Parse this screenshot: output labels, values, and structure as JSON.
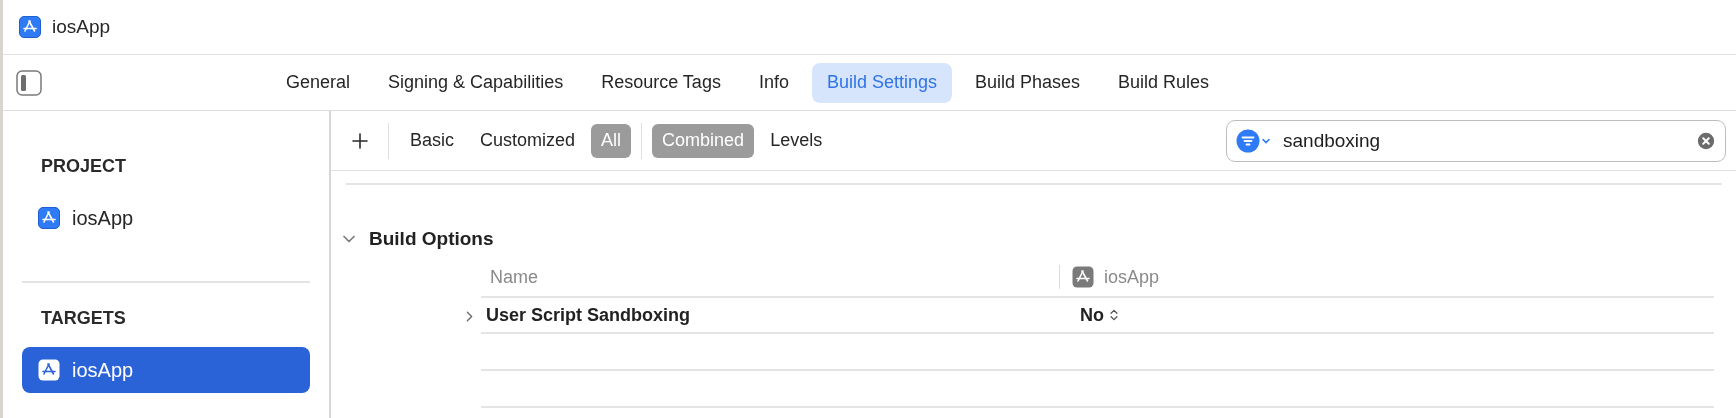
{
  "window": {
    "title": "iosApp"
  },
  "tabs": [
    {
      "label": "General",
      "selected": false
    },
    {
      "label": "Signing & Capabilities",
      "selected": false
    },
    {
      "label": "Resource Tags",
      "selected": false
    },
    {
      "label": "Info",
      "selected": false
    },
    {
      "label": "Build Settings",
      "selected": true
    },
    {
      "label": "Build Phases",
      "selected": false
    },
    {
      "label": "Build Rules",
      "selected": false
    }
  ],
  "sidebar": {
    "sections": [
      {
        "heading": "PROJECT",
        "items": [
          {
            "label": "iosApp",
            "selected": false
          }
        ]
      },
      {
        "heading": "TARGETS",
        "items": [
          {
            "label": "iosApp",
            "selected": true
          }
        ]
      }
    ]
  },
  "filter_bar": {
    "scopes": [
      {
        "label": "Basic",
        "selected": false
      },
      {
        "label": "Customized",
        "selected": false
      },
      {
        "label": "All",
        "selected": true
      }
    ],
    "views": [
      {
        "label": "Combined",
        "selected": true
      },
      {
        "label": "Levels",
        "selected": false
      }
    ],
    "search": {
      "value": "sandboxing"
    }
  },
  "settings": {
    "groups": [
      {
        "title": "Build Options",
        "expanded": true,
        "columns": [
          "Name",
          "iosApp"
        ],
        "rows": [
          {
            "name": "User Script Sandboxing",
            "value": "No",
            "expanded": false
          }
        ]
      }
    ]
  }
}
